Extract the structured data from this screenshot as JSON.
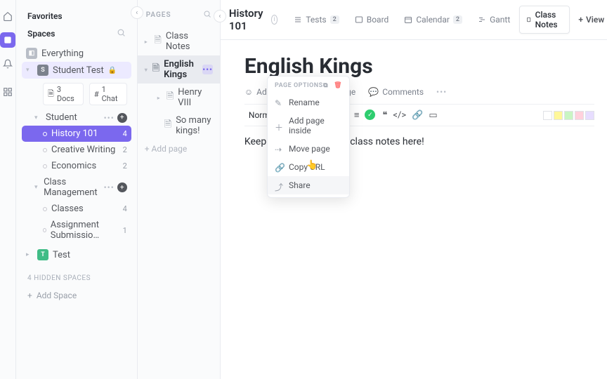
{
  "sidebar": {
    "favorites": "Favorites",
    "spaces": "Spaces",
    "everything": "Everything",
    "student_space": "Student Test",
    "docs_pill": "3 Docs",
    "chat_pill": "1 Chat",
    "folders": {
      "student": {
        "label": "Student"
      },
      "class_mgmt": {
        "label": "Class Management"
      }
    },
    "lists": {
      "history": {
        "label": "History 101",
        "count": "4"
      },
      "creative": {
        "label": "Creative Writing",
        "count": "2"
      },
      "econ": {
        "label": "Economics",
        "count": "2"
      },
      "classes": {
        "label": "Classes",
        "count": "4"
      },
      "assign": {
        "label": "Assignment Submissio…",
        "count": "1"
      }
    },
    "test_space": "Test",
    "hidden": "4 HIDDEN SPACES",
    "add_space": "Add Space"
  },
  "pages": {
    "header": "PAGES",
    "items": {
      "class_notes": "Class Notes",
      "english_kings": "English Kings",
      "henry": "Henry VIII",
      "so_many": "So many kings!"
    },
    "add_page": "+ Add page"
  },
  "topbar": {
    "breadcrumb": "History 101",
    "views": {
      "tests": {
        "label": "Tests",
        "badge": "2"
      },
      "board": "Board",
      "calendar": {
        "label": "Calendar",
        "badge": "2"
      },
      "gantt": "Gantt",
      "class_notes": "Class Notes",
      "add_view": "View"
    }
  },
  "doc": {
    "title": "English Kings",
    "meta": {
      "add_icon": "Add Icon",
      "share": "Share Page",
      "comments": "Comments"
    },
    "format": "Normal",
    "body": "Keep track of all of your class notes here!"
  },
  "ctx": {
    "header": "PAGE OPTIONS",
    "rename": "Rename",
    "add_inside": "Add page inside",
    "move": "Move page",
    "copy_url": "Copy URL",
    "share": "Share"
  },
  "colors": {
    "swatches": [
      "#ffffff",
      "#fff79a",
      "#c9f5c3",
      "#ffd1dc",
      "#e7ddff"
    ]
  }
}
